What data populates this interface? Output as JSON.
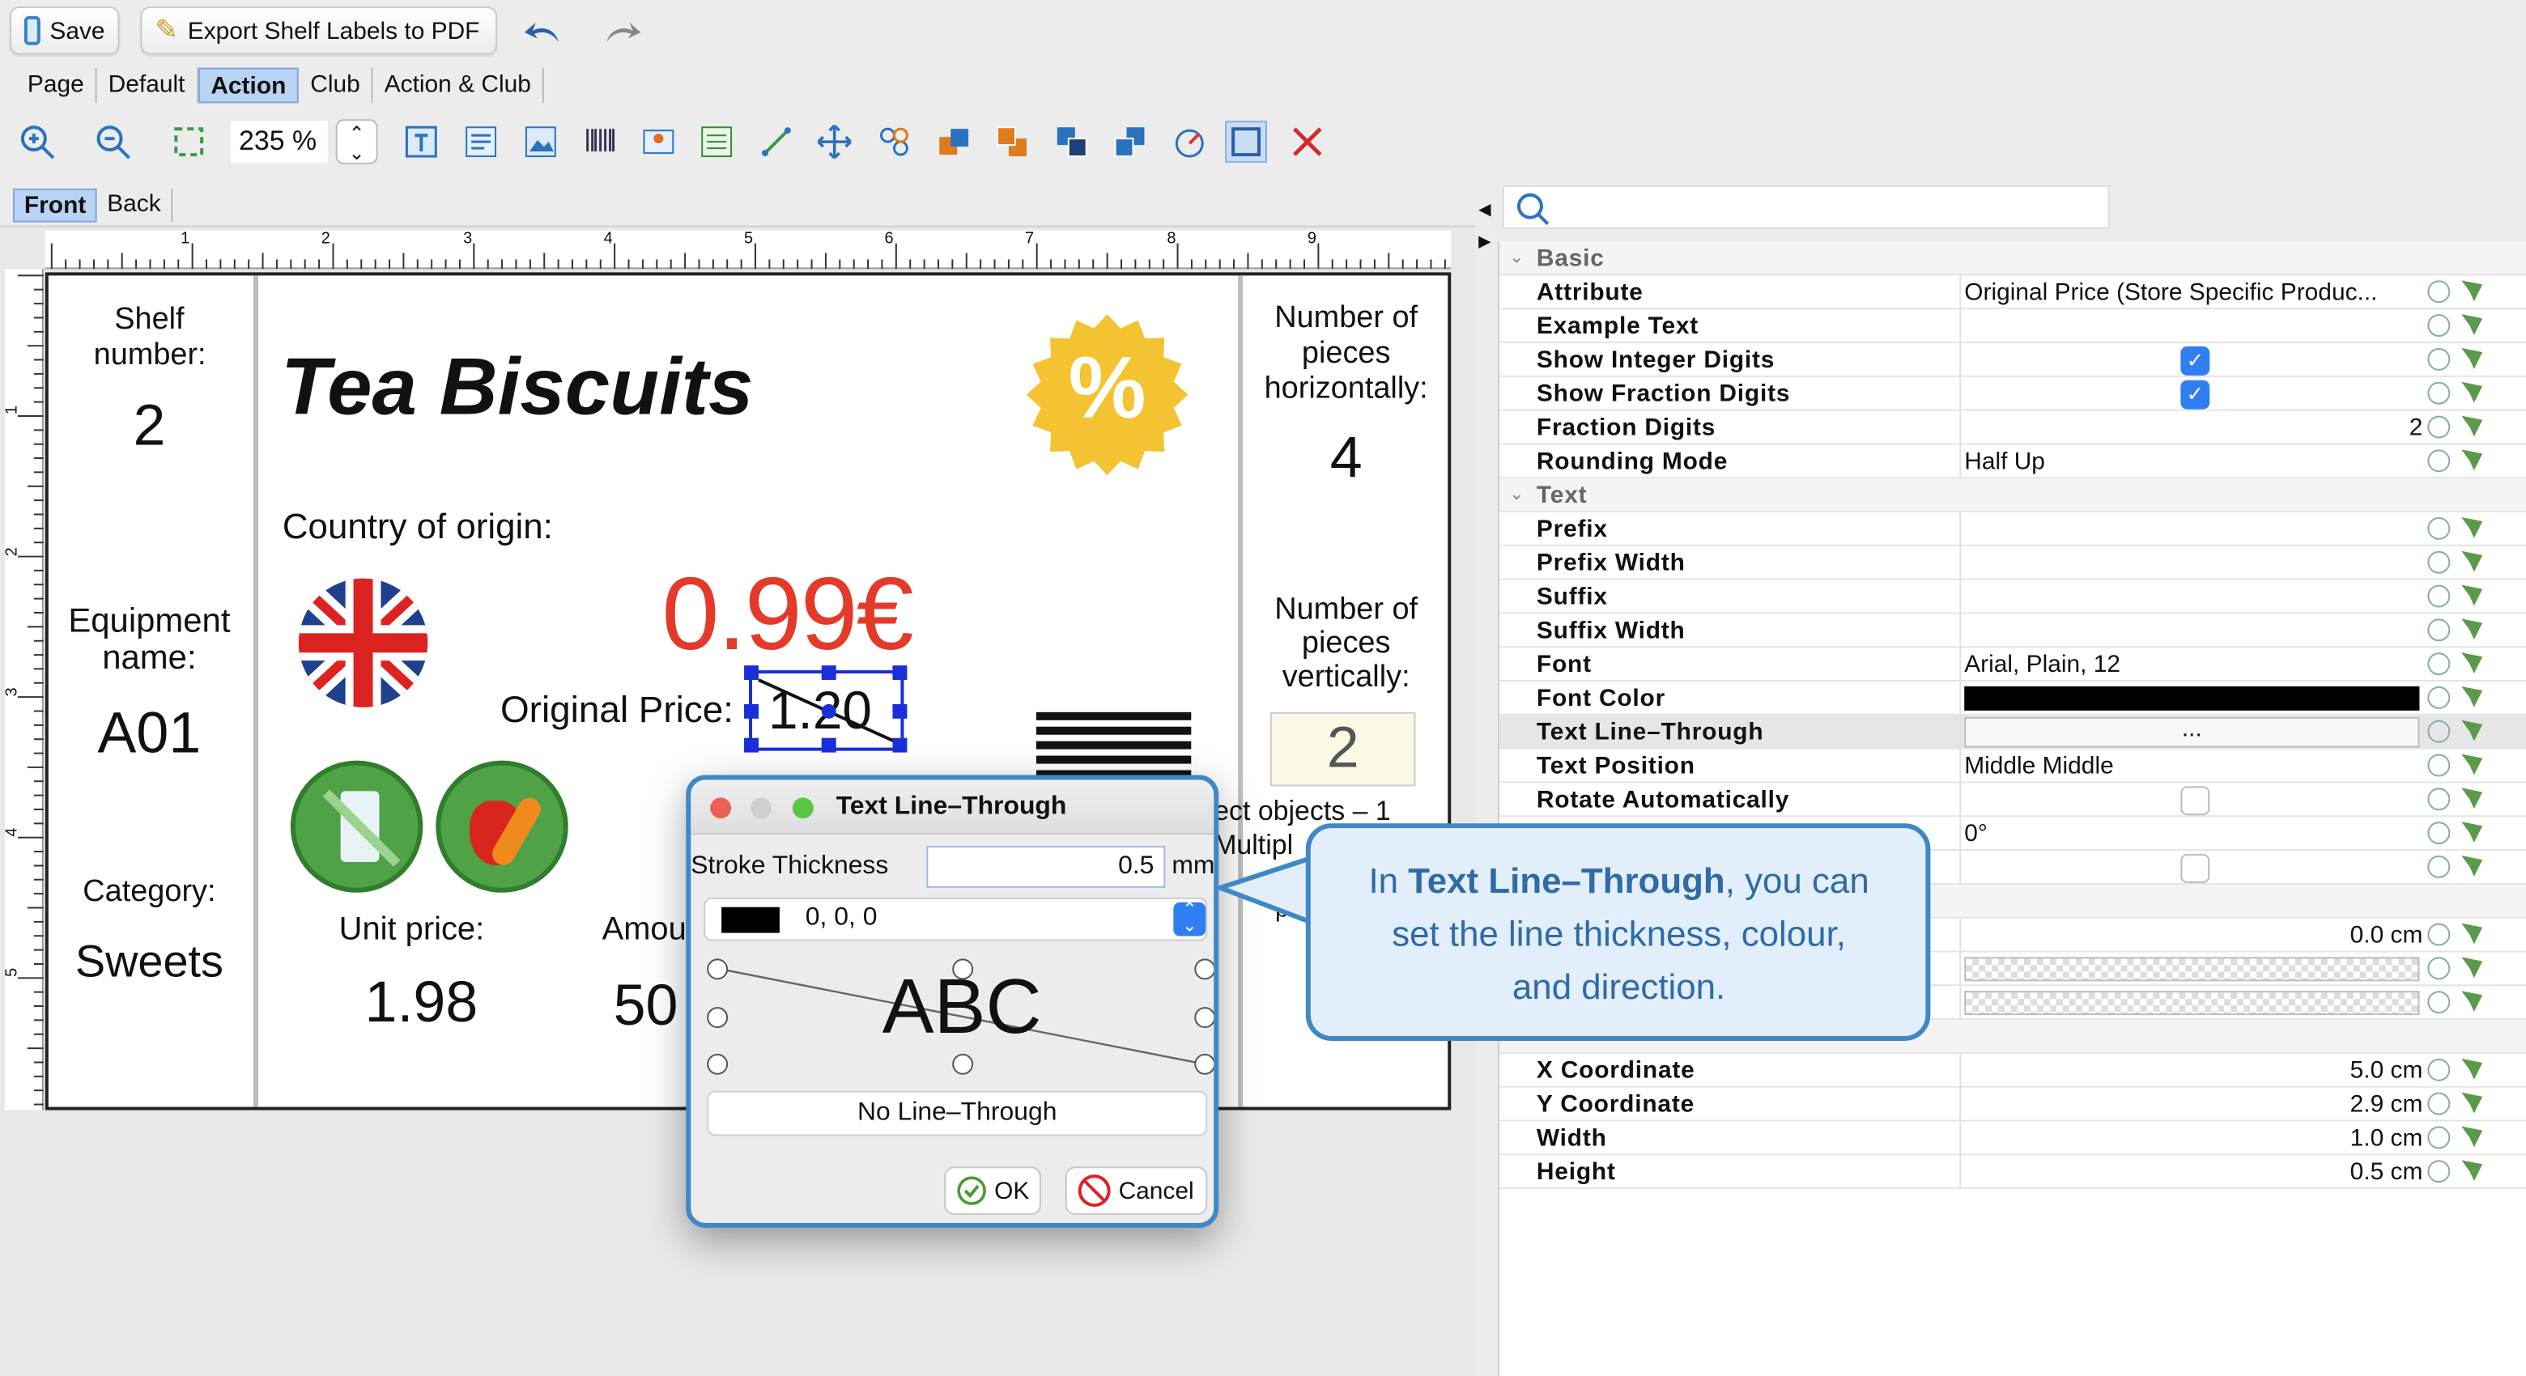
{
  "toolbar": {
    "save": "Save",
    "export": "Export Shelf Labels to PDF",
    "zoom": "235 %"
  },
  "tabs": [
    "Page",
    "Default",
    "Action",
    "Club",
    "Action & Club"
  ],
  "side_tabs": [
    "Front",
    "Back"
  ],
  "ruler": [
    "1",
    "2",
    "3",
    "4",
    "5",
    "6",
    "7",
    "8",
    "9"
  ],
  "vruler": [
    "1",
    "2",
    "3",
    "4",
    "5"
  ],
  "label": {
    "shelf_label": "Shelf number:",
    "shelf_value": "2",
    "equipment_label": "Equipment name:",
    "equipment_value": "A01",
    "category_label": "Category:",
    "category_value": "Sweets",
    "title": "Tea Biscuits",
    "percent": "%",
    "country": "Country of origin:",
    "price": "0.99€",
    "orig_label": "Original Price:",
    "orig_value": "1.20",
    "unit_label": "Unit price:",
    "unit_value": "1.98",
    "amount_label": "Amou",
    "amount_value": "50",
    "horiz_label": "Number of pieces horizontally:",
    "horiz_value": "4",
    "vert_label": "Number of pieces vertically:",
    "vert_value": "2",
    "obscured1": "ect objects – 1",
    "obscured2": "Multipl",
    "obscured3": "pi"
  },
  "props": {
    "basic": "Basic",
    "text": "Text",
    "rows": [
      {
        "k": "Attribute",
        "v": "Original Price (Store Specific Produc..."
      },
      {
        "k": "Example Text",
        "v": ""
      },
      {
        "k": "Show Integer Digits",
        "v": ""
      },
      {
        "k": "Show Fraction Digits",
        "v": ""
      },
      {
        "k": "Fraction Digits",
        "v": "2"
      },
      {
        "k": "Rounding Mode",
        "v": "Half Up"
      },
      {
        "k": "Prefix",
        "v": ""
      },
      {
        "k": "Prefix Width",
        "v": ""
      },
      {
        "k": "Suffix",
        "v": ""
      },
      {
        "k": "Suffix Width",
        "v": ""
      },
      {
        "k": "Font",
        "v": "Arial, Plain, 12"
      },
      {
        "k": "Font Color",
        "v": ""
      },
      {
        "k": "Text Line–Through",
        "v": "..."
      },
      {
        "k": "Text Position",
        "v": "Middle Middle"
      },
      {
        "k": "Rotate Automatically",
        "v": ""
      },
      {
        "k": "",
        "v": "0°"
      },
      {
        "k": "X Coordinate",
        "v": "5.0 cm"
      },
      {
        "k": "Y Coordinate",
        "v": "2.9 cm"
      },
      {
        "k": "Width",
        "v": "1.0 cm"
      },
      {
        "k": "Height",
        "v": "0.5 cm"
      }
    ],
    "hidden_value": "0.0 cm"
  },
  "dialog": {
    "title": "Text Line–Through",
    "stroke_label": "Stroke Thickness",
    "stroke_value": "0.5",
    "unit": "mm",
    "color": "0, 0, 0",
    "preview": "ABC",
    "no_line": "No Line–Through",
    "ok": "OK",
    "cancel": "Cancel"
  },
  "callout": {
    "pre": "In ",
    "bold": "Text Line–Through",
    "post": ", you can set the line thickness, colour, and direction."
  }
}
